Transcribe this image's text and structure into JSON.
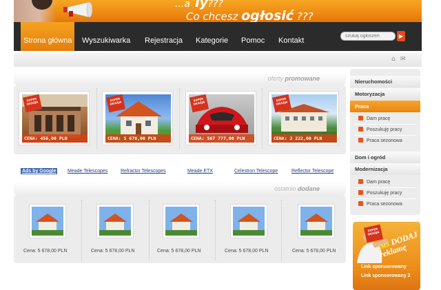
{
  "banner": {
    "slogan_line1": "...a ",
    "slogan_line1_bold": "Ty",
    "slogan_line1_tail": "???",
    "slogan_line2": "Co chcesz ",
    "slogan_line2_bold": "ogłosić",
    "slogan_line2_tail": " ???"
  },
  "nav": {
    "items": [
      "Strona główna",
      "Wyszukiwarka",
      "Rejestracja",
      "Kategorie",
      "Pomoc",
      "Kontakt"
    ],
    "active_index": 0
  },
  "search": {
    "placeholder": "szukaj ogłoszeń",
    "button_icon": "arrow-right-icon"
  },
  "util": {
    "icons": [
      "home-icon",
      "mail-icon"
    ]
  },
  "promoted": {
    "title_prefix": "oferty ",
    "title_bold": "promowane",
    "badge": "SUPER OKAZJA",
    "items": [
      {
        "price": "CENA: 456,00 PLN"
      },
      {
        "price": "CENA: 5 678,00 PLN"
      },
      {
        "price": "CENA: 567 777,00 PLN"
      },
      {
        "price": "CENA: 2 222,00 PLN"
      }
    ]
  },
  "ads": {
    "label": "Ads by Google",
    "links": [
      "Meade Telescopes",
      "Refractor Telescopes",
      "Meade ETX",
      "Celestron Telescope",
      "Reflector Telescope"
    ]
  },
  "recent": {
    "title_prefix": "ostatnio ",
    "title_bold": "dodane",
    "items": [
      {
        "price": "Cena: 5 678,00 PLN"
      },
      {
        "price": "Cena: 5 678,00 PLN"
      },
      {
        "price": "Cena: 5 678,00 PLN"
      },
      {
        "price": "Cena: 5 678,00 PLN"
      },
      {
        "price": "Cena: 5 678,00 PLN"
      }
    ]
  },
  "sidebar": {
    "categories": [
      {
        "label": "Nieruchomości",
        "active": false,
        "subs": []
      },
      {
        "label": "Motoryzacja",
        "active": false,
        "subs": []
      },
      {
        "label": "Praca",
        "active": true,
        "subs": [
          "Dam pracę",
          "Poszukuję pracy",
          "Praca sezonowa"
        ]
      },
      {
        "label": "Dom i ogród",
        "active": false,
        "subs": []
      },
      {
        "label": "Modernizacja",
        "active": false,
        "subs": [
          "Dam pracę",
          "Poszukuję pracy",
          "Praca sezonowa"
        ]
      }
    ]
  },
  "sms_box": {
    "badge": "SUPER OKAZJA",
    "sms": "SMS",
    "line1": "DODAJ",
    "line2": "reklamę",
    "links": [
      "Link sponsorowany",
      "Link sponsorowany 2"
    ]
  },
  "colors": {
    "accent": "#ef8a12",
    "nav_bg": "#2b2b2b",
    "price_bar": "#d64314",
    "ads_blue": "#3e67b3"
  }
}
